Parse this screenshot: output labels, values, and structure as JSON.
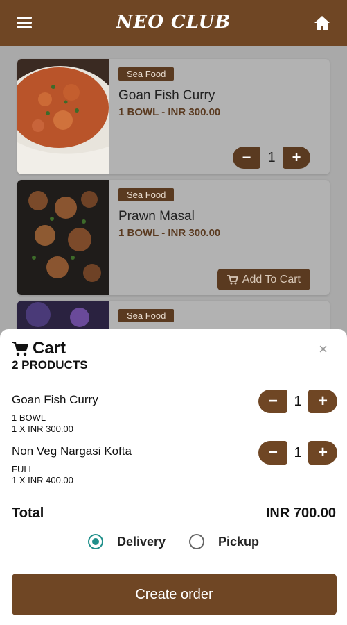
{
  "header": {
    "title": "NEO CLUB",
    "menu_icon": "menu-icon",
    "home_icon": "home-icon",
    "color": "#6f4624"
  },
  "menu": [
    {
      "tag": "Sea Food",
      "name": "Goan Fish Curry",
      "price": "1 BOWL - INR 300.00",
      "qty": "1"
    },
    {
      "tag": "Sea Food",
      "name": "Prawn Masal",
      "price": "1 BOWL - INR 300.00",
      "add_label": "Add To Cart"
    },
    {
      "tag": "Sea Food"
    }
  ],
  "cart": {
    "title": "Cart",
    "count": "2 PRODUCTS",
    "close": "×",
    "items": [
      {
        "name": "Goan Fish Curry",
        "variant": "1 BOWL",
        "price": "1 X INR 300.00",
        "qty": "1"
      },
      {
        "name": "Non Veg Nargasi Kofta",
        "variant": "FULL",
        "price": "1 X INR 400.00",
        "qty": "1"
      }
    ],
    "total_label": "Total",
    "total_value": "INR 700.00",
    "options": [
      {
        "label": "Delivery",
        "selected": true
      },
      {
        "label": "Pickup",
        "selected": false
      }
    ],
    "create_label": "Create order",
    "accent": "#1f8f8a"
  }
}
